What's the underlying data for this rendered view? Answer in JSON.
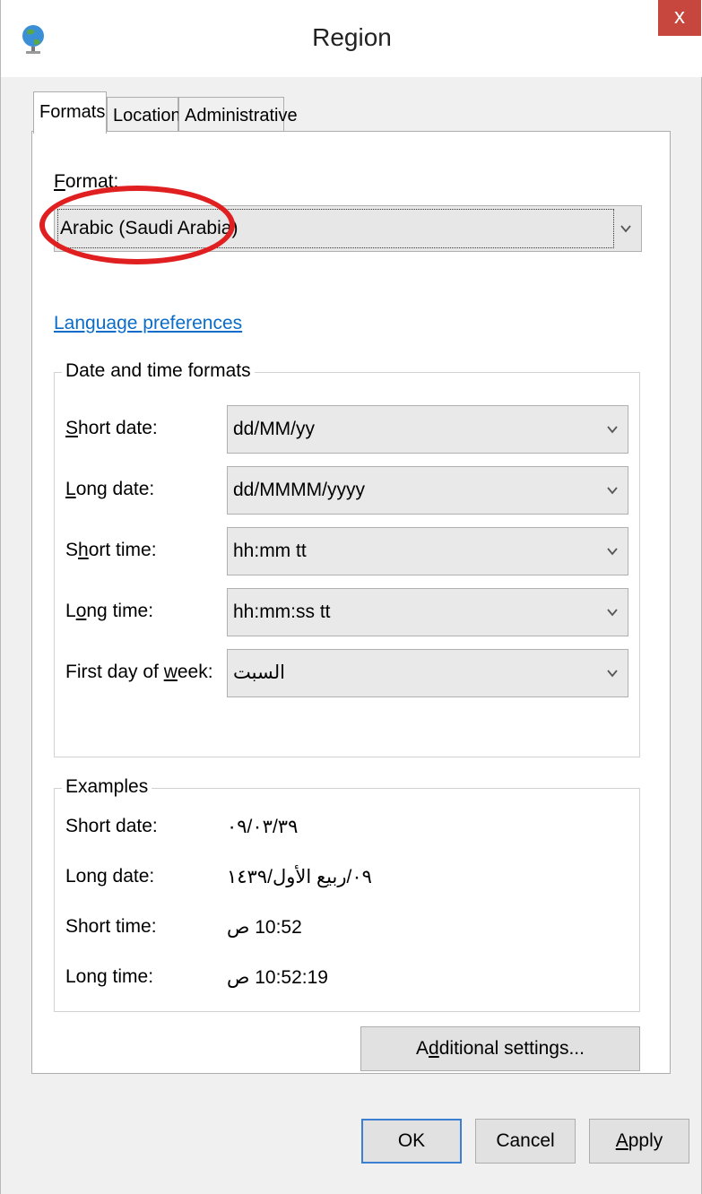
{
  "window": {
    "title": "Region",
    "close_label": "x"
  },
  "tabs": [
    {
      "label": "Formats"
    },
    {
      "label": "Location"
    },
    {
      "label": "Administrative"
    }
  ],
  "format": {
    "label_u": "F",
    "label_rest": "ormat:",
    "value": "Arabic (Saudi Arabia)"
  },
  "language_link": "Language preferences",
  "date_time_formats": {
    "title": "Date and time formats",
    "rows": [
      {
        "label_u": "S",
        "label_rest": "hort date:",
        "value": "dd/MM/yy"
      },
      {
        "label_u": "L",
        "label_rest": "ong date:",
        "value": "dd/MMMM/yyyy"
      },
      {
        "label_pre": "S",
        "label_u": "h",
        "label_rest": "ort time:",
        "value": "hh:mm tt"
      },
      {
        "label_pre": "L",
        "label_u": "o",
        "label_rest": "ng time:",
        "value": "hh:mm:ss tt"
      },
      {
        "label_pre": "First day of ",
        "label_u": "w",
        "label_rest": "eek:",
        "value": "السبت"
      }
    ]
  },
  "examples": {
    "title": "Examples",
    "rows": [
      {
        "label": "Short date:",
        "value": "٠٩/٠٣/٣٩"
      },
      {
        "label": "Long date:",
        "value": "٠٩/ربيع الأول/١٤٣٩"
      },
      {
        "label": "Short time:",
        "value": "10:52 ص"
      },
      {
        "label": "Long time:",
        "value": "10:52:19 ص"
      }
    ]
  },
  "buttons": {
    "additional_pre": "A",
    "additional_u": "d",
    "additional_rest": "ditional settings...",
    "ok": "OK",
    "cancel": "Cancel",
    "apply_u": "A",
    "apply_rest": "pply"
  },
  "colors": {
    "close_button": "#c7463e",
    "link": "#0b6dc9",
    "highlight_oval": "#e02020",
    "default_button_border": "#3c7fd2"
  }
}
